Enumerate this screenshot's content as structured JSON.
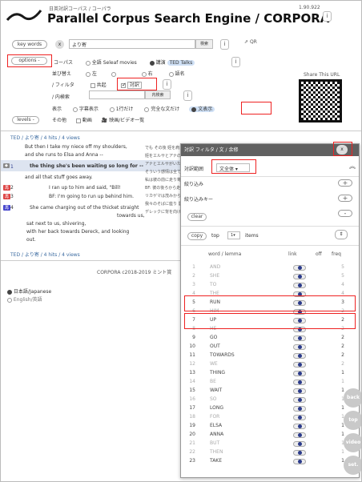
{
  "header": {
    "subtitle": "日英対訳コーパス / コーパラ",
    "version": "1.90.922",
    "title": "Parallel Corpus Search Engine / CORPORA",
    "info": "i"
  },
  "search": {
    "keywords_label": "key words",
    "clear_x": "x",
    "query": "より寄",
    "search_btn": "検索",
    "qr_label": "QR",
    "options_label": "options -"
  },
  "options": {
    "corpus_label": "コーパス",
    "corpus_opt1": "全語 Seleaf movies",
    "corpus_opt2": "講演",
    "corpus_opt2_tag": "TED Talks",
    "sort_label": "並び替え",
    "sort_opts": [
      "左",
      "",
      "右",
      "語名"
    ],
    "filter_label": "/ フィルタ",
    "filter_opt1": "共起",
    "filter_opt2": "対訳",
    "inner_label": "/ 内検索",
    "inner_btn": "内検索",
    "display_label": "表示",
    "display_opts": [
      "字幕表示",
      "1行だけ",
      "完全な文だけ",
      "文表示"
    ],
    "other_label": "その他",
    "other_opts": [
      "動画",
      "映画/ビデオ一覧"
    ],
    "levels_label": "levels -",
    "share_label": "Share This URL"
  },
  "results": {
    "summary": "TED / より寄 / 4 hits / 4 views",
    "lines": [
      "But then I take my niece off my shoulders,",
      "and she runs to Elsa and Anna --",
      "the thing she's been waiting so long for --",
      "and all that stuff goes away.",
      "I ran up to him and said, \"Bill!",
      "BF: I'm going to run up behind him.",
      "She came charging out of the thicket straight",
      "towards us,",
      "sat next to us, shivering,",
      "with her back towards Dereck, and looking",
      "out."
    ],
    "jp_lines": [
      "でも その後 姪を肩から降ろすと",
      "姪をエルサとアナの所へ",
      "アナとエルサがいた",
      "そういう感情は全て消えました",
      "私は彼の前に走り寄りこう",
      "BF: 彼の後ろから走り寄ります",
      "リカゲマは茂みから突然飛び出し",
      "",
      "我々のそばに座り 震えながら",
      "デレックに背を向けて",
      ""
    ],
    "nums": [
      "1",
      "2",
      "3",
      "4"
    ],
    "summary2": "TED / より寄 / 4 hits / 4 views",
    "footer": "CORPORA c2018-2019 ミント賞",
    "lang1": "日本語/Japanese",
    "lang2": "English/英語"
  },
  "dialog": {
    "title": "対訳 フィルタ / 文 / 余修",
    "close": "x",
    "range_label": "対訳範囲",
    "range_value": "文全体",
    "narrow_label": "絞り込み",
    "narrow_key": "絞り込みキー",
    "plus": "+",
    "minus": "-",
    "clear_label": "clear",
    "copy_label": "copy",
    "top_label": "top",
    "top_value": "1",
    "items_label": "items",
    "col_word": "word / lemma",
    "col_link": "link",
    "col_off": "off",
    "col_freq": "freq",
    "words": [
      {
        "n": "1",
        "w": "AND",
        "f": "5",
        "g": true
      },
      {
        "n": "2",
        "w": "SHE",
        "f": "5",
        "g": true
      },
      {
        "n": "3",
        "w": "TO",
        "f": "4",
        "g": true
      },
      {
        "n": "4",
        "w": "THE",
        "f": "4",
        "g": true
      },
      {
        "n": "5",
        "w": "RUN",
        "f": "3",
        "g": false
      },
      {
        "n": "6",
        "w": "HIM",
        "f": "2",
        "g": true
      },
      {
        "n": "7",
        "w": "UP",
        "f": "2",
        "g": false
      },
      {
        "n": "8",
        "w": "HE",
        "f": "2",
        "g": true
      },
      {
        "n": "9",
        "w": "GO",
        "f": "2",
        "g": false
      },
      {
        "n": "10",
        "w": "OUT",
        "f": "2",
        "g": false
      },
      {
        "n": "11",
        "w": "TOWARDS",
        "f": "2",
        "g": false
      },
      {
        "n": "12",
        "w": "WE",
        "f": "2",
        "g": true
      },
      {
        "n": "13",
        "w": "THING",
        "f": "1",
        "g": false
      },
      {
        "n": "14",
        "w": "BE",
        "f": "1",
        "g": true
      },
      {
        "n": "15",
        "w": "WAIT",
        "f": "1",
        "g": false
      },
      {
        "n": "16",
        "w": "SO",
        "f": "1",
        "g": true
      },
      {
        "n": "17",
        "w": "LONG",
        "f": "1",
        "g": false
      },
      {
        "n": "18",
        "w": "FOR",
        "f": "1",
        "g": true
      },
      {
        "n": "19",
        "w": "ELSA",
        "f": "1",
        "g": false
      },
      {
        "n": "20",
        "w": "ANNA",
        "f": "1",
        "g": false
      },
      {
        "n": "21",
        "w": "BUT",
        "f": "1",
        "g": true
      },
      {
        "n": "22",
        "w": "THEN",
        "f": "1",
        "g": true
      },
      {
        "n": "23",
        "w": "TAKE",
        "f": "1",
        "g": false
      }
    ]
  },
  "fabs": [
    "back",
    "top",
    "video",
    "set."
  ]
}
